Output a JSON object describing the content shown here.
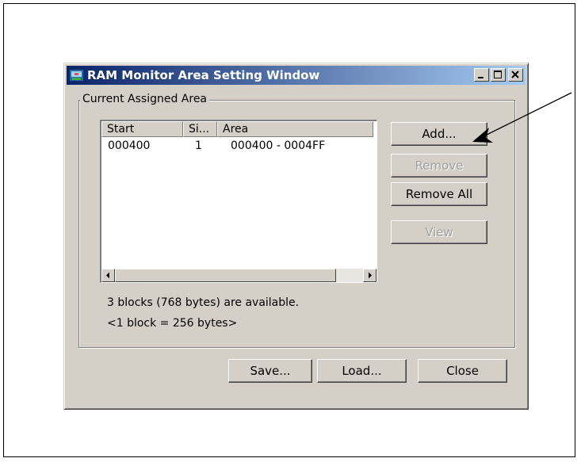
{
  "window": {
    "title": "RAM Monitor Area Setting Window",
    "buttons": {
      "minimize": "minimize-icon",
      "maximize": "maximize-icon",
      "close": "close-icon"
    }
  },
  "group": {
    "label": "Current Assigned Area"
  },
  "table": {
    "columns": [
      "Start",
      "Si...",
      "Area"
    ],
    "rows": [
      {
        "start": "000400",
        "size": "1",
        "area": "000400 - 0004FF"
      }
    ]
  },
  "actions": {
    "add": "Add...",
    "remove": "Remove",
    "remove_all": "Remove All",
    "view": "View"
  },
  "info": {
    "available": "3 blocks (768 bytes) are available.",
    "block_size": "<1 block = 256 bytes>"
  },
  "footer": {
    "save": "Save...",
    "load": "Load...",
    "close": "Close"
  },
  "colors": {
    "face": "#d4d0c8",
    "title_start": "#0a246a",
    "title_end": "#a6caf0",
    "disabled_text": "#a0a0a0"
  }
}
